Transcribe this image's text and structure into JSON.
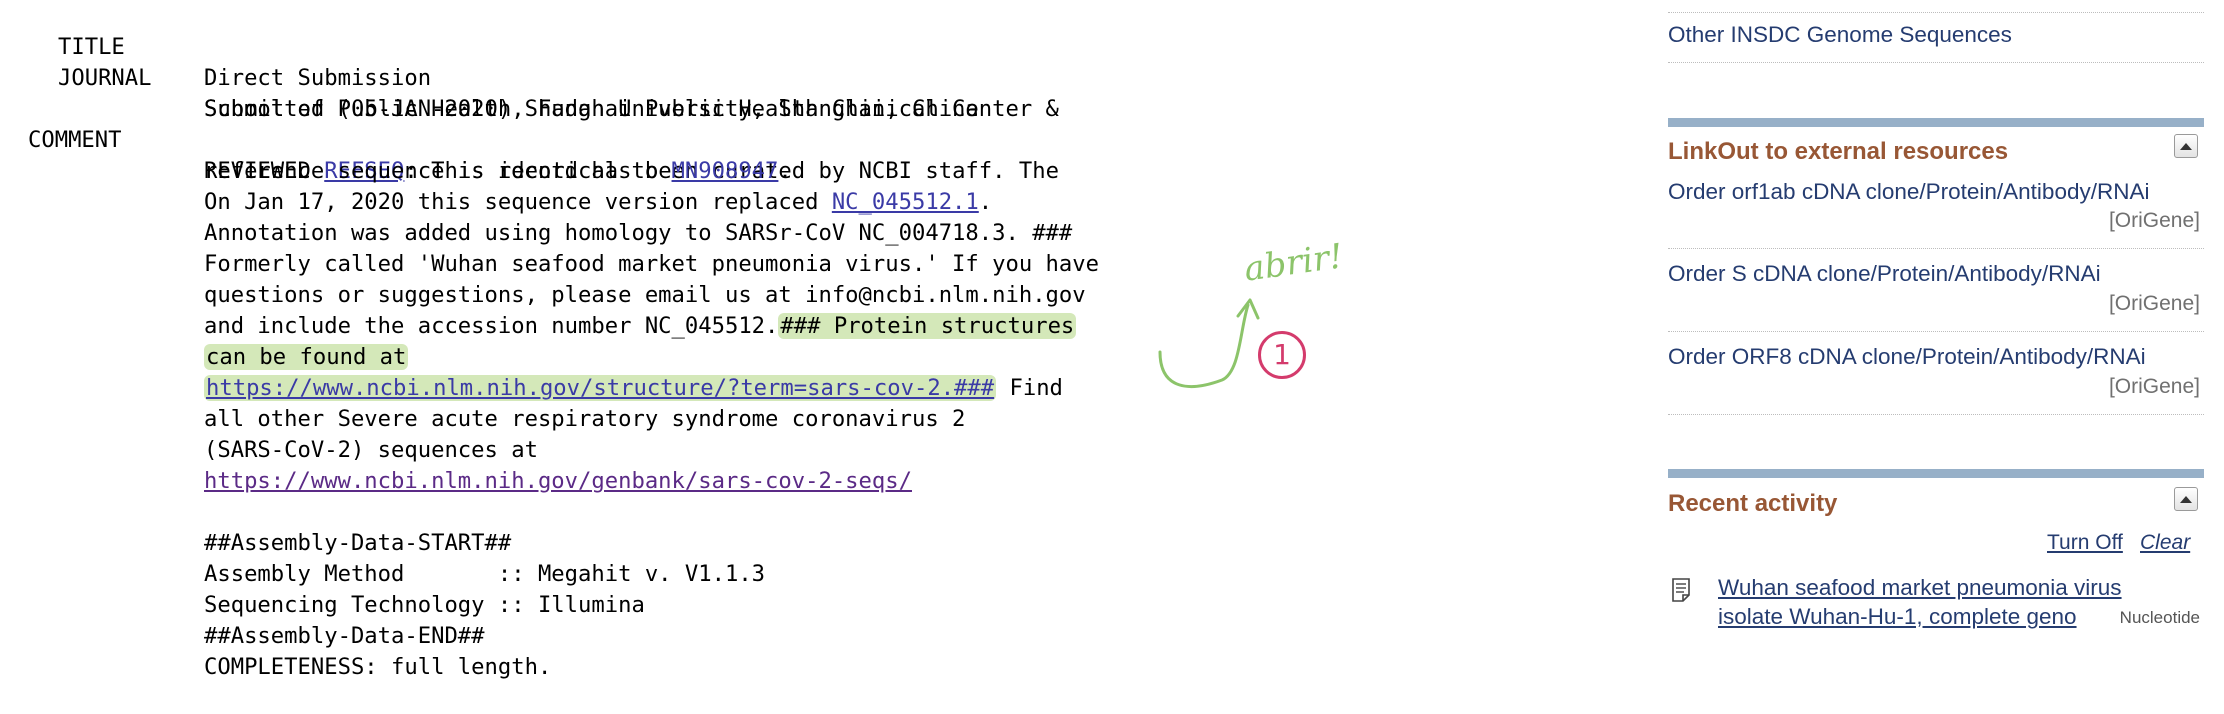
{
  "record": {
    "title_label": "TITLE",
    "title_value": "Direct Submission",
    "journal_label": "JOURNAL",
    "journal_lines": [
      "Submitted (05-JAN-2020) Shanghai Public Health Clinical Center &",
      "School of Public Health, Fudan University, Shanghai, China"
    ],
    "comment_label": "COMMENT",
    "comment": {
      "l1_pre": "REVIEWED ",
      "l1_link": "REFSEQ",
      "l1_post": ": This record has been curated by NCBI staff. The",
      "l2_pre": "reference sequence is identical to ",
      "l2_link": "MN908947",
      "l2_post": ".",
      "l3_pre": "On Jan 17, 2020 this sequence version replaced ",
      "l3_link": "NC_045512.1",
      "l3_post": ".",
      "l4": "Annotation was added using homology to SARSr-CoV NC_004718.3. ###",
      "l5": "Formerly called 'Wuhan seafood market pneumonia virus.' If you have",
      "l6": "questions or suggestions, please email us at info@ncbi.nlm.nih.gov",
      "l7_pre": "and include the accession number NC_045512.",
      "l7_hl": "### Protein structures",
      "l8_hl": "can be found at",
      "l9_link": "https://www.ncbi.nlm.nih.gov/structure/?term=sars-cov-2.###",
      "l9_post": " Find",
      "l10": "all other Severe acute respiratory syndrome coronavirus 2",
      "l11": "(SARS-CoV-2) sequences at",
      "l12_link": "https://www.ncbi.nlm.nih.gov/genbank/sars-cov-2-seqs/",
      "l14": "##Assembly-Data-START##",
      "l15": "Assembly Method       :: Megahit v. V1.1.3",
      "l16": "Sequencing Technology :: Illumina",
      "l17": "##Assembly-Data-END##",
      "l18": "COMPLETENESS: full length."
    }
  },
  "annotation": {
    "note": "abrir!",
    "number": "1",
    "color_note": "#8cc46a",
    "color_number": "#d43b6c"
  },
  "sidebar": {
    "top_link": "Other INSDC Genome Sequences",
    "linkout": {
      "title": "LinkOut to external resources",
      "items": [
        {
          "label": "Order orf1ab cDNA clone/Protein/Antibody/RNAi",
          "source": "[OriGene]"
        },
        {
          "label": "Order S cDNA clone/Protein/Antibody/RNAi",
          "source": "[OriGene]"
        },
        {
          "label": "Order ORF8 cDNA clone/Protein/Antibody/RNAi",
          "source": "[OriGene]"
        }
      ]
    },
    "recent": {
      "title": "Recent activity",
      "turn_off": "Turn Off",
      "clear": "Clear",
      "item_line1": "Wuhan seafood market pneumonia virus",
      "item_line2": "isolate Wuhan-Hu-1, complete geno",
      "item_db": "Nucleotide"
    },
    "colors": {
      "portal_title": "#985735",
      "link": "#253c70",
      "portal_bar": "#97b0c8"
    }
  }
}
